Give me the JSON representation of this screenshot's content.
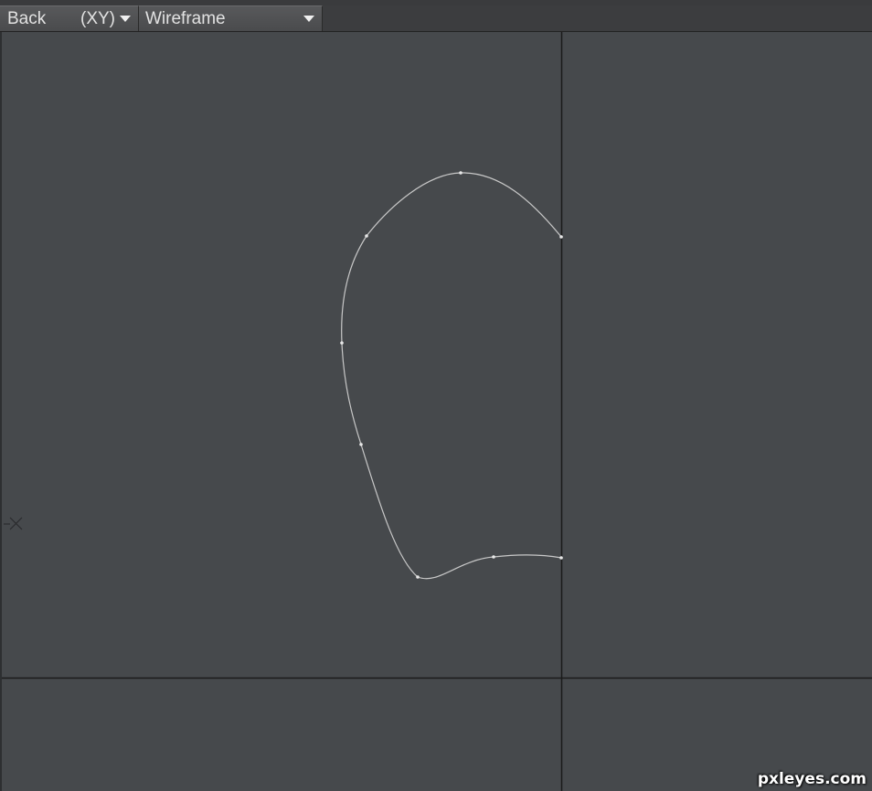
{
  "toolbar": {
    "view_label": "Back",
    "axis_label": "(XY)",
    "mode_label": "Wireframe"
  },
  "viewport": {
    "background_color": "#46494c",
    "axis_line_color": "#1a1a1a",
    "curve_color": "#c8c8c8",
    "point_color": "#e8e8e8"
  },
  "watermark": {
    "text": "pxleyes.com"
  }
}
